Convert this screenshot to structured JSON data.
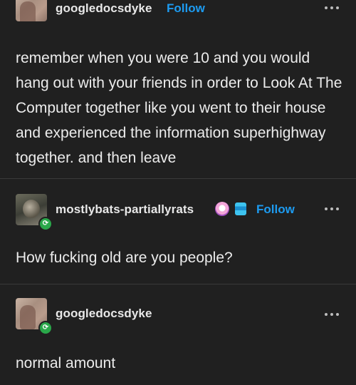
{
  "posts": [
    {
      "username": "googledocsdyke",
      "follow_label": "Follow",
      "body": "remember when you were 10 and you would hang out with your friends in order to Look At The Computer together like you went to their house and experienced the information superhighway together. and then leave"
    },
    {
      "username": "mostlybats-partiallyrats",
      "follow_label": "Follow",
      "body": "How fucking old are you people?"
    },
    {
      "username": "googledocsdyke",
      "body": "normal amount"
    }
  ],
  "colors": {
    "accent": "#1d9bf0",
    "background": "#202020",
    "reblog_green": "#2aa84a"
  },
  "icons": {
    "more": "more-options-icon",
    "reblog": "reblog-icon"
  }
}
